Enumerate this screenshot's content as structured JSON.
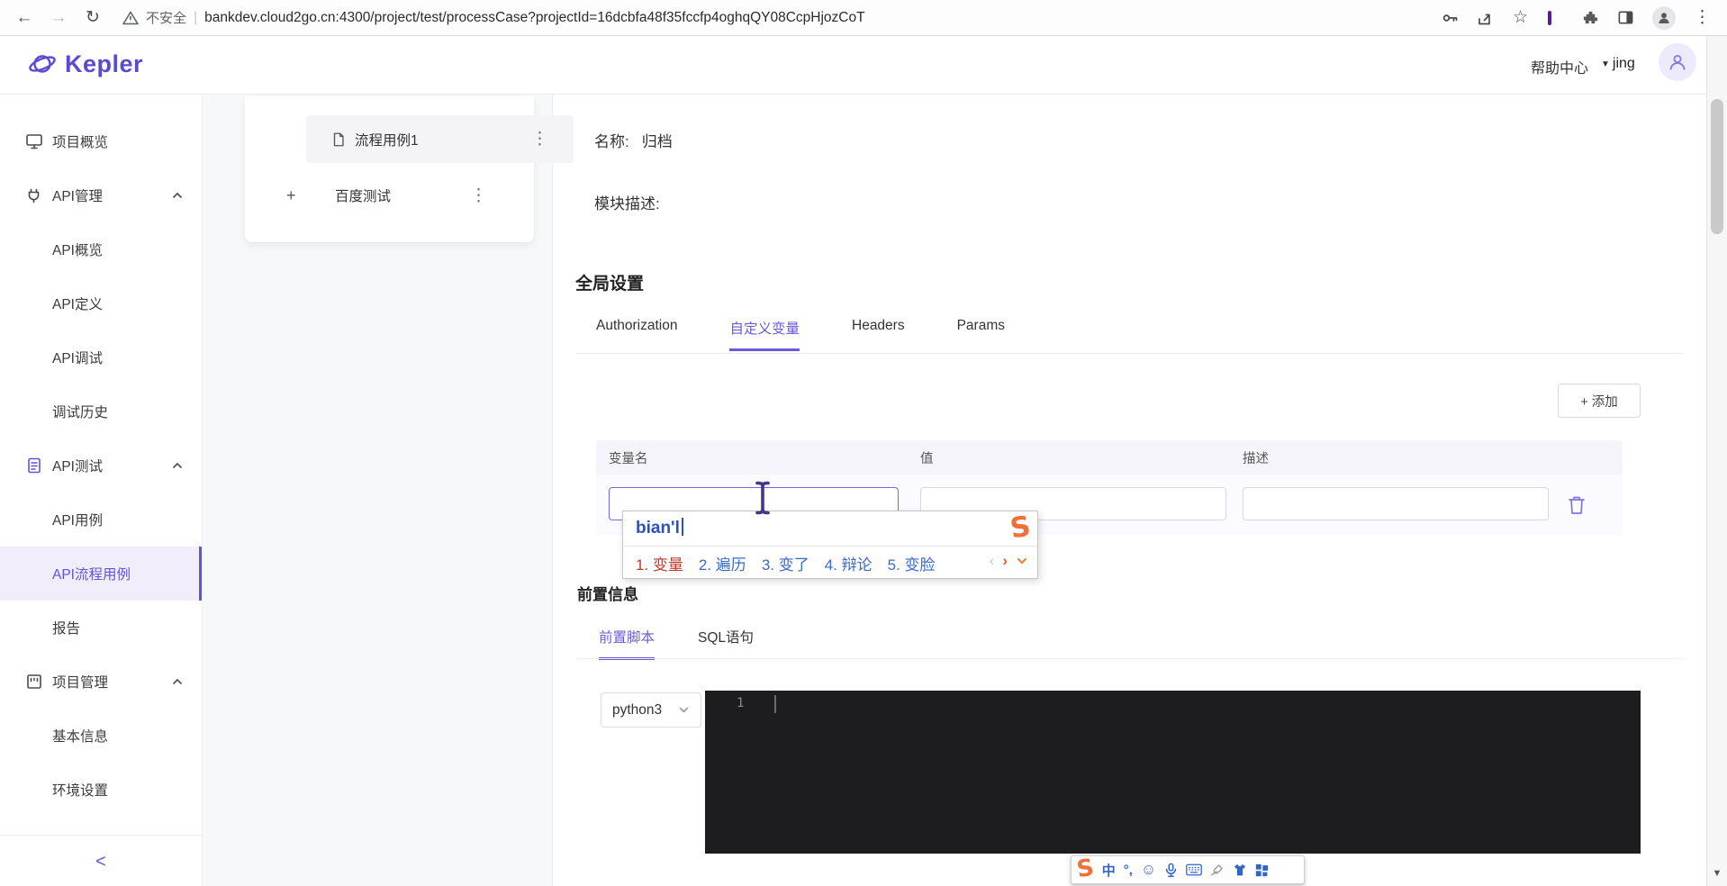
{
  "browser": {
    "security_label": "不安全",
    "url": "bankdev.cloud2go.cn:4300/project/test/processCase?projectId=16dcbfa48f35fccfp4oghqQY08CcpHjozCoT"
  },
  "header": {
    "logo_text": "Kepler",
    "help_label": "帮助中心",
    "username": "jing"
  },
  "sidebar": {
    "items": [
      {
        "label": "项目概览"
      },
      {
        "label": "API管理"
      },
      {
        "label": "API概览"
      },
      {
        "label": "API定义"
      },
      {
        "label": "API调试"
      },
      {
        "label": "调试历史"
      },
      {
        "label": "API测试"
      },
      {
        "label": "API用例"
      },
      {
        "label": "API流程用例"
      },
      {
        "label": "报告"
      },
      {
        "label": "项目管理"
      },
      {
        "label": "基本信息"
      },
      {
        "label": "环境设置"
      }
    ],
    "active_item": "API流程用例"
  },
  "tree": {
    "expand_plus": "+",
    "items": [
      {
        "label": "流程用例1"
      },
      {
        "label": "百度测试"
      }
    ]
  },
  "main": {
    "name_label": "名称:",
    "name_value": "归档",
    "module_desc_label": "模块描述:",
    "global_settings_title": "全局设置",
    "tabs": [
      {
        "label": "Authorization"
      },
      {
        "label": "自定义变量"
      },
      {
        "label": "Headers"
      },
      {
        "label": "Params"
      }
    ],
    "active_tab": "自定义变量",
    "add_button_label": "+ 添加",
    "table_headers": [
      {
        "label": "变量名"
      },
      {
        "label": "值"
      },
      {
        "label": "描述"
      }
    ],
    "pre_info_title": "前置信息",
    "pre_tabs": [
      {
        "label": "前置脚本"
      },
      {
        "label": "SQL语句"
      }
    ],
    "active_pre_tab": "前置脚本",
    "language_selected": "python3",
    "editor_line_number": "1"
  },
  "ime": {
    "composition": "bian'l",
    "candidates": [
      {
        "text": "1. 变量"
      },
      {
        "text": "2. 遍历"
      },
      {
        "text": "3. 变了"
      },
      {
        "text": "4. 辩论"
      },
      {
        "text": "5. 变脸"
      }
    ],
    "toolbar_mode": "中",
    "toolbar_punct": "°,"
  },
  "icons": {
    "back": "←",
    "forward": "→",
    "reload": "↻",
    "star": "☆",
    "menu_dots": "⋮",
    "caret_down": "▼",
    "prev": "‹",
    "next": "›",
    "smiley": "☺",
    "sogou_logo": "S",
    "collapse": "<",
    "scroll_down": "▼"
  },
  "colors": {
    "primary_purple": "#6254d3",
    "ime_blue": "#3a6bc8",
    "ime_red": "#c03a28",
    "sogou_orange": "#f0703a",
    "editor_bg": "#1d1d1f"
  }
}
